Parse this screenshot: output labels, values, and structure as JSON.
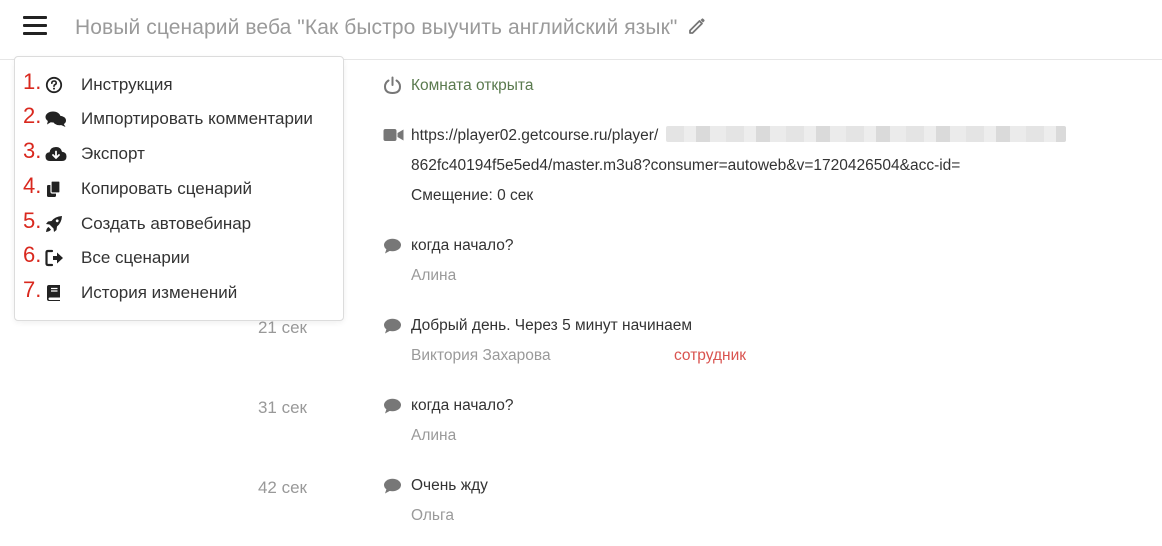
{
  "header": {
    "title": "Новый сценарий веба \"Как быстро выучить английский язык\"",
    "menu_icon": "hamburger-icon",
    "edit_icon": "pencil-icon"
  },
  "menu": {
    "items": [
      {
        "num": "1.",
        "label": "Инструкция",
        "icon": "question-circle-icon"
      },
      {
        "num": "2.",
        "label": "Импортировать комментарии",
        "icon": "comments-icon"
      },
      {
        "num": "3.",
        "label": "Экспорт",
        "icon": "cloud-download-icon"
      },
      {
        "num": "4.",
        "label": "Копировать сценарий",
        "icon": "copy-icon"
      },
      {
        "num": "5.",
        "label": "Создать автовебинар",
        "icon": "rocket-icon"
      },
      {
        "num": "6.",
        "label": "Все сценарии",
        "icon": "sign-out-icon"
      },
      {
        "num": "7.",
        "label": "История изменений",
        "icon": "book-icon"
      }
    ]
  },
  "timeline": {
    "room": {
      "label": "Комната открыта",
      "icon": "power-icon"
    },
    "video": {
      "url_line1": "https://player02.getcourse.ru/player/",
      "url_line2": "862fc40194f5e5ed4/master.m3u8?consumer=autoweb&v=1720426504&acc-id=",
      "offset": "Смещение: 0 сек",
      "icon": "video-camera-icon"
    },
    "comments": [
      {
        "time": "",
        "text": "когда начало?",
        "author": "Алина",
        "role": ""
      },
      {
        "time": "21 сек",
        "text": "Добрый день. Через 5 минут начинаем",
        "author": "Виктория Захарова",
        "role": "сотрудник"
      },
      {
        "time": "31 сек",
        "text": "когда начало?",
        "author": "Алина",
        "role": ""
      },
      {
        "time": "42 сек",
        "text": "Очень жду",
        "author": "Ольга",
        "role": ""
      }
    ]
  },
  "colors": {
    "accent_red": "#d9281e",
    "role_red": "#d9534f",
    "room_green": "#5a7a4e",
    "muted": "#9a9a9a"
  }
}
